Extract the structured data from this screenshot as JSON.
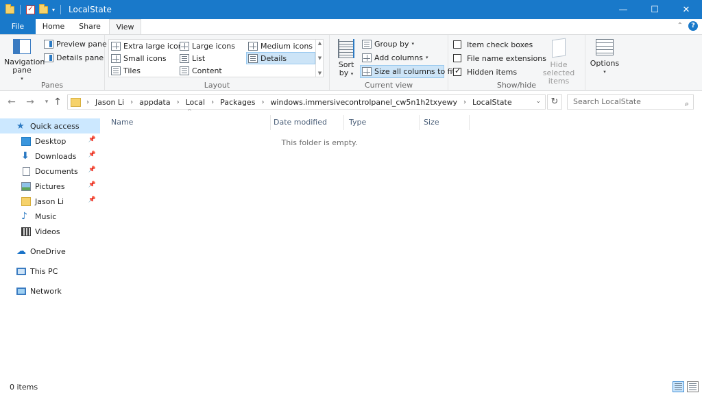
{
  "window": {
    "title": "LocalState",
    "minimize": "—",
    "maximize": "☐",
    "close": "✕"
  },
  "ribbon_tabs": [
    "File",
    "Home",
    "Share",
    "View"
  ],
  "ribbon_minimize": "⌃",
  "help": "?",
  "ribbon": {
    "panes": {
      "navigation_pane": "Navigation pane",
      "preview_pane": "Preview pane",
      "details_pane": "Details pane",
      "label": "Panes"
    },
    "layout": {
      "items": [
        "Extra large icons",
        "Large icons",
        "Medium icons",
        "Small icons",
        "List",
        "Details",
        "Tiles",
        "Content"
      ],
      "selected": "Details",
      "label": "Layout"
    },
    "current_view": {
      "sort_by": "Sort by",
      "group_by": "Group by",
      "add_columns": "Add columns",
      "size_all_columns": "Size all columns to fit",
      "label": "Current view"
    },
    "show_hide": {
      "item_check_boxes": "Item check boxes",
      "item_check_boxes_checked": false,
      "file_name_extensions": "File name extensions",
      "file_name_extensions_checked": false,
      "hidden_items": "Hidden items",
      "hidden_items_checked": true,
      "hide_selected_items": "Hide selected items",
      "label": "Show/hide"
    },
    "options": "Options"
  },
  "address": {
    "breadcrumbs": [
      "Jason Li",
      "appdata",
      "Local",
      "Packages",
      "windows.immersivecontrolpanel_cw5n1h2txyewy",
      "LocalState"
    ],
    "search_placeholder": "Search LocalState"
  },
  "nav": {
    "items": [
      {
        "label": "Quick access",
        "icon": "star-icon",
        "pinned": false
      },
      {
        "label": "Desktop",
        "icon": "desktop-icon",
        "pinned": true
      },
      {
        "label": "Downloads",
        "icon": "download-icon",
        "pinned": true
      },
      {
        "label": "Documents",
        "icon": "documents-icon",
        "pinned": true
      },
      {
        "label": "Pictures",
        "icon": "pictures-icon",
        "pinned": true
      },
      {
        "label": "Jason Li",
        "icon": "folder-icon",
        "pinned": true
      },
      {
        "label": "Music",
        "icon": "music-icon",
        "pinned": false
      },
      {
        "label": "Videos",
        "icon": "videos-icon",
        "pinned": false
      },
      {
        "label": "OneDrive",
        "icon": "onedrive-icon",
        "pinned": false
      },
      {
        "label": "This PC",
        "icon": "this-pc-icon",
        "pinned": false
      },
      {
        "label": "Network",
        "icon": "network-icon",
        "pinned": false
      }
    ]
  },
  "columns": [
    "Name",
    "Date modified",
    "Type",
    "Size"
  ],
  "empty_message": "This folder is empty.",
  "status": {
    "item_count": "0 items"
  },
  "colors": {
    "accent": "#1979ca",
    "selection": "#cce8ff"
  }
}
